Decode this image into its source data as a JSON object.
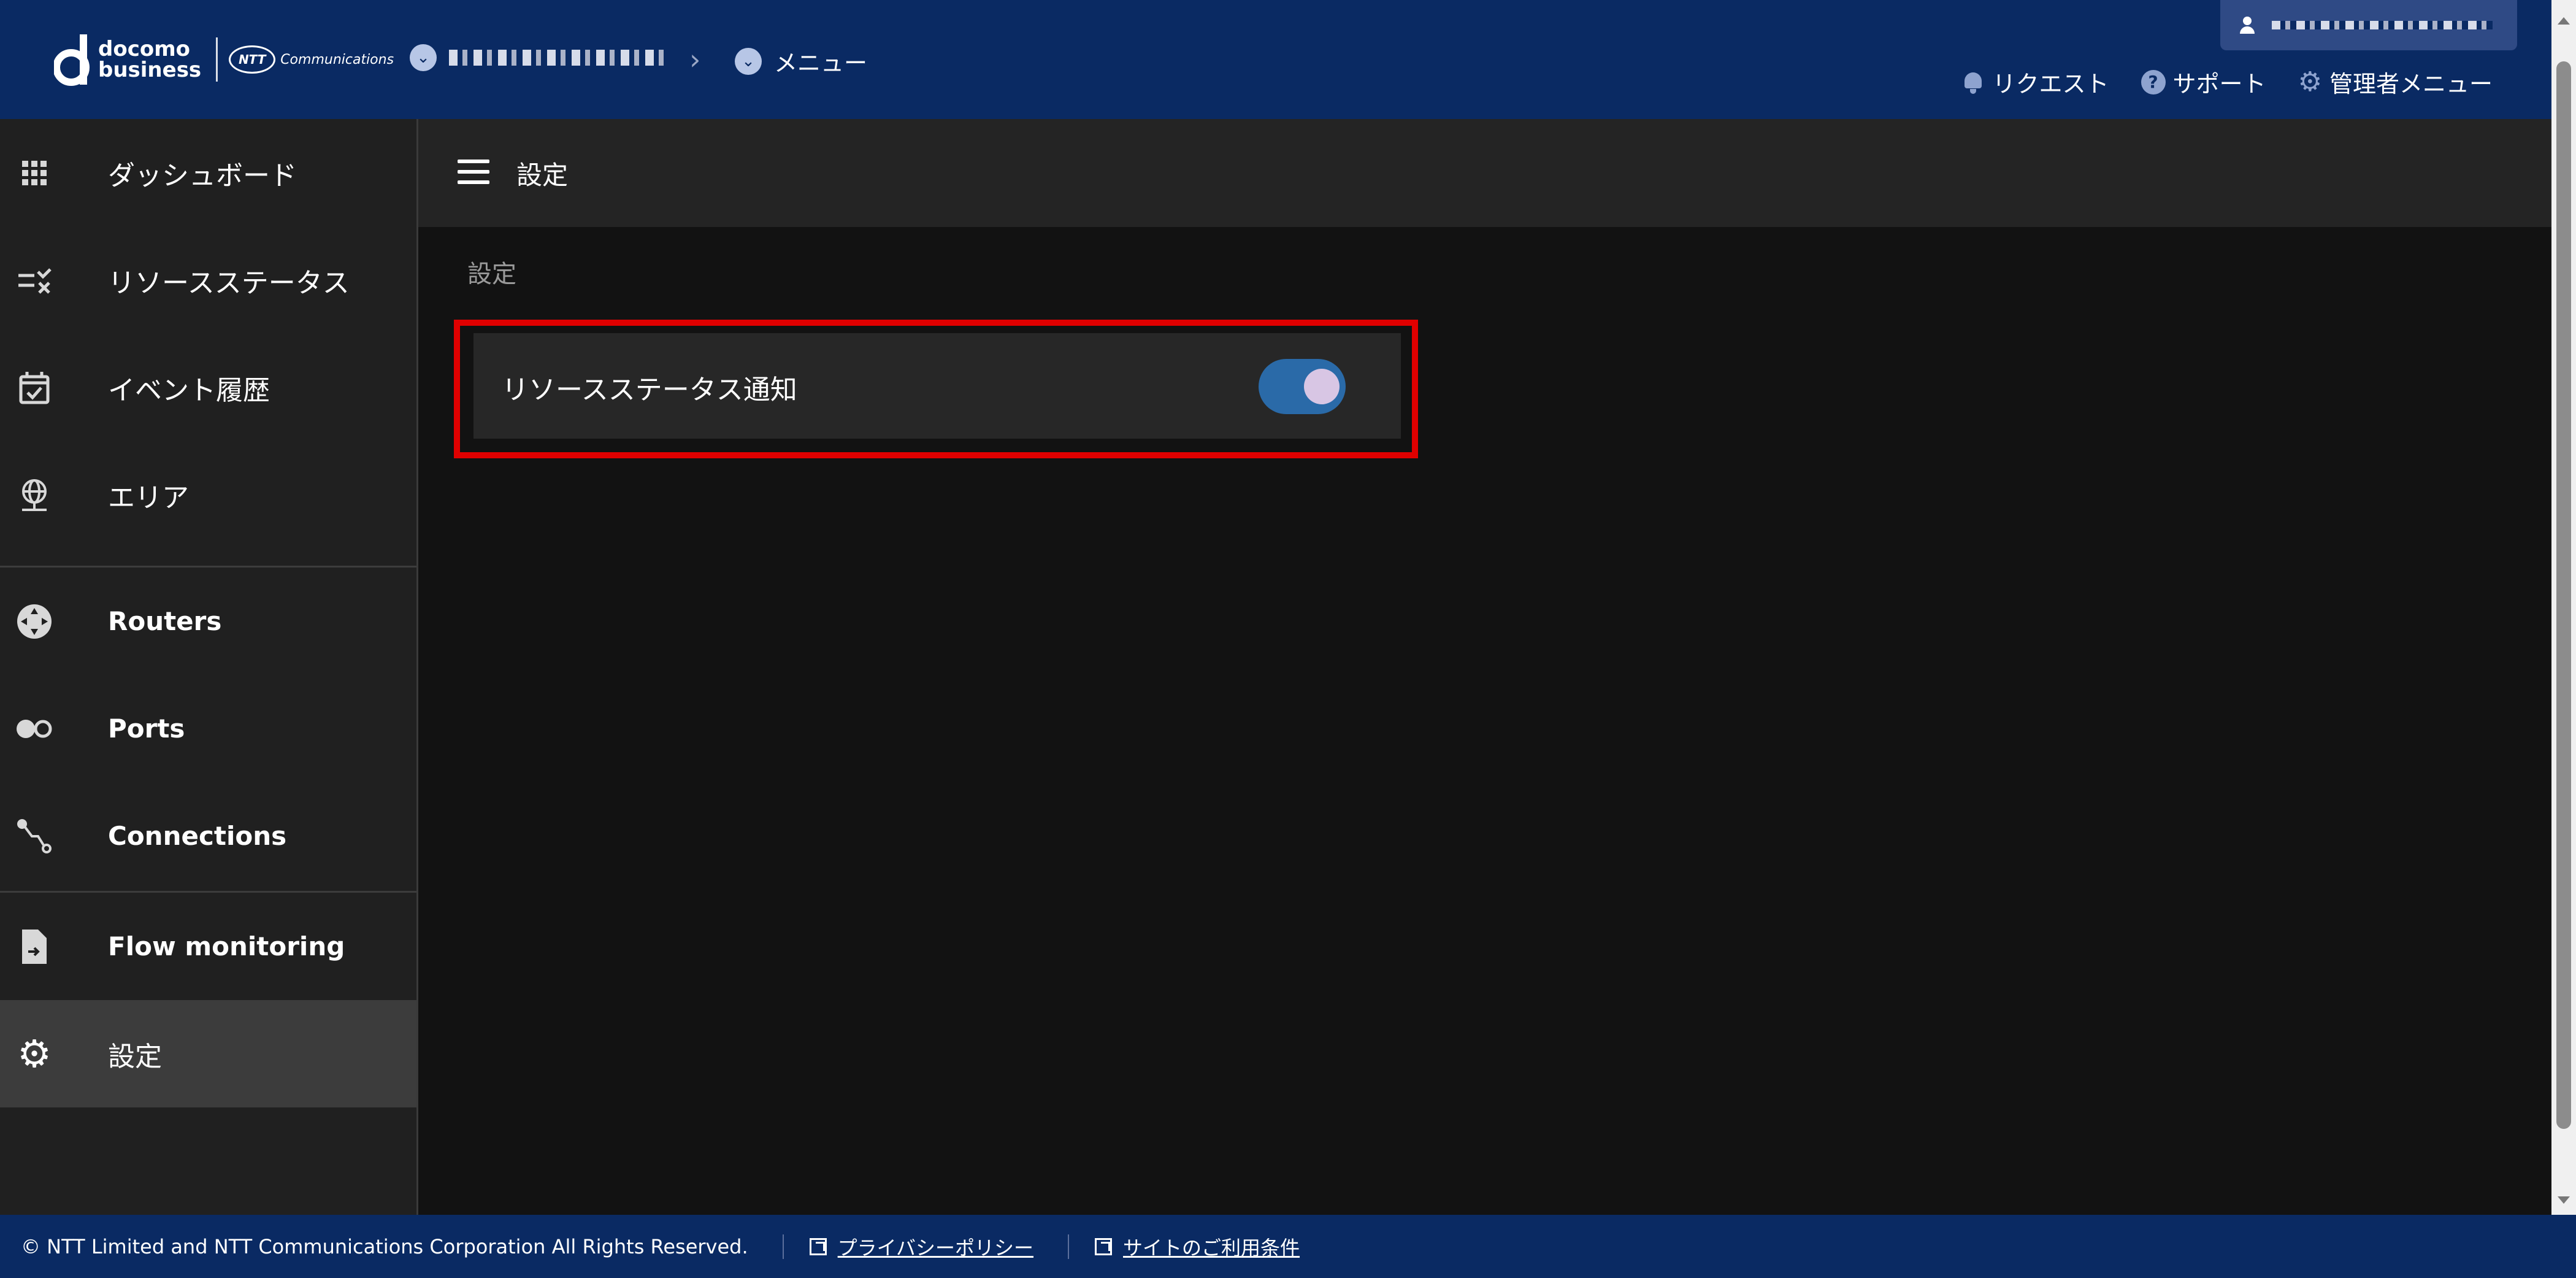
{
  "header": {
    "brand": {
      "line1": "docomo",
      "line2": "business",
      "partner": "NTT",
      "partner_sub": "Communications"
    },
    "breadcrumb": {
      "menu_label": "メニュー"
    },
    "links": [
      {
        "label": "リクエスト",
        "icon": "bell-icon"
      },
      {
        "label": "サポート",
        "icon": "help-icon"
      },
      {
        "label": "管理者メニュー",
        "icon": "gear-icon"
      }
    ]
  },
  "sidebar": {
    "items": [
      {
        "label": "ダッシュボード",
        "icon": "grid-icon"
      },
      {
        "label": "リソースステータス",
        "icon": "checklist-icon"
      },
      {
        "label": "イベント履歴",
        "icon": "calendar-check-icon"
      },
      {
        "label": "エリア",
        "icon": "globe-icon"
      },
      {
        "label": "Routers",
        "icon": "router-icon"
      },
      {
        "label": "Ports",
        "icon": "ports-icon"
      },
      {
        "label": "Connections",
        "icon": "connections-icon"
      },
      {
        "label": "Flow monitoring",
        "icon": "flow-doc-icon"
      },
      {
        "label": "設定",
        "icon": "gear-icon",
        "active": true
      }
    ]
  },
  "content": {
    "page_title": "設定",
    "section_title": "設定",
    "settings": [
      {
        "label": "リソースステータス通知",
        "enabled": true
      }
    ]
  },
  "footer": {
    "copyright": "© NTT Limited and NTT Communications Corporation All Rights Reserved.",
    "links": [
      "プライバシーポリシー",
      "サイトのご利用条件"
    ]
  },
  "colors": {
    "header_bg": "#0a2a63",
    "toggle_on": "#2a6aa8",
    "highlight": "#e00000"
  }
}
